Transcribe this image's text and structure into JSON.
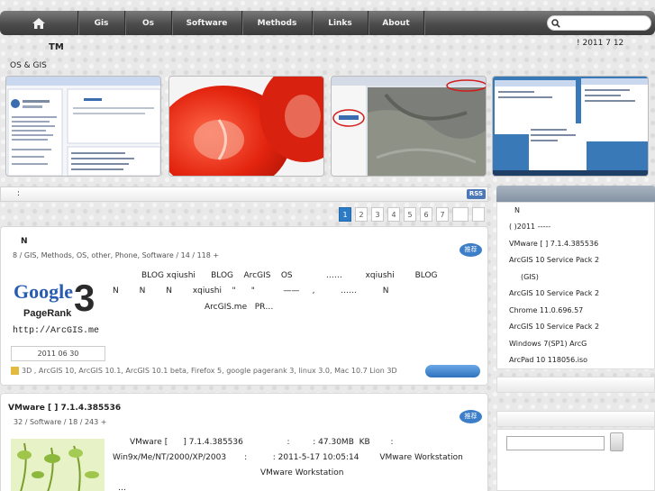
{
  "nav": {
    "home_icon": "home-icon",
    "items": [
      "Gis",
      "Os",
      "Software",
      "Methods",
      "Links",
      "About"
    ],
    "search_icon": "search-icon"
  },
  "header": {
    "title": "TM",
    "date": "! 2011  7  12",
    "subtitle": "OS & GIS"
  },
  "slides": [
    "screenshot-window",
    "tomato-photo",
    "arcgis-map-window",
    "windows-desktop"
  ],
  "infobar": {
    "colon": ":",
    "rss": "RSS"
  },
  "pagination": [
    "1",
    "2",
    "3",
    "4",
    "5",
    "6",
    "7",
    "",
    ""
  ],
  "posts": [
    {
      "title": "N",
      "meta": "8  / GIS, Methods, OS, other, Phone, Software  /    14  /    118  +",
      "badge": "推荐",
      "thumb": {
        "word": "Google",
        "num": "3",
        "sub": "PageRank",
        "url": "http://ArcGIS.me"
      },
      "line1": "BLOG xqiushi      BLOG    ArcGIS    OS             ……         xqiushi        BLOG",
      "line2": "N        N        N        xqiushi    \"      \"           ——     ,          ……          N",
      "line3": "ArcGIS.me   PR…",
      "date": "2011  06  30",
      "tags": "3D   ,  ArcGIS 10, ArcGIS 10.1, ArcGIS 10.1 beta, Firefox 5, google pagerank 3, linux 3.0, Mac 10.7 Lion 3D"
    },
    {
      "title": "VMware [       ] 7.1.4.385536",
      "meta": "32  / Software  /    18  /    243  +",
      "badge": "推荐",
      "line1": "VMware [      ] 7.1.4.385536                 :         : 47.30MB  KB        :",
      "line2": "Win9x/Me/NT/2000/XP/2003       :          : 2011-5-17 10:05:14        VMware Workstation",
      "line3": "VMware Workstation",
      "line4": "…"
    }
  ],
  "sidebar": {
    "items": [
      "N",
      "( )2011      -----",
      "VMware [    ] 7.1.4.385536",
      "ArcGIS 10 Service Pack 2",
      "(GIS)",
      "ArcGIS 10 Service Pack 2",
      "Chrome 11.0.696.57",
      "ArcGIS 10 Service Pack 2",
      "Windows 7(SP1)      ArcG",
      "ArcPad 10 118056.iso"
    ]
  }
}
